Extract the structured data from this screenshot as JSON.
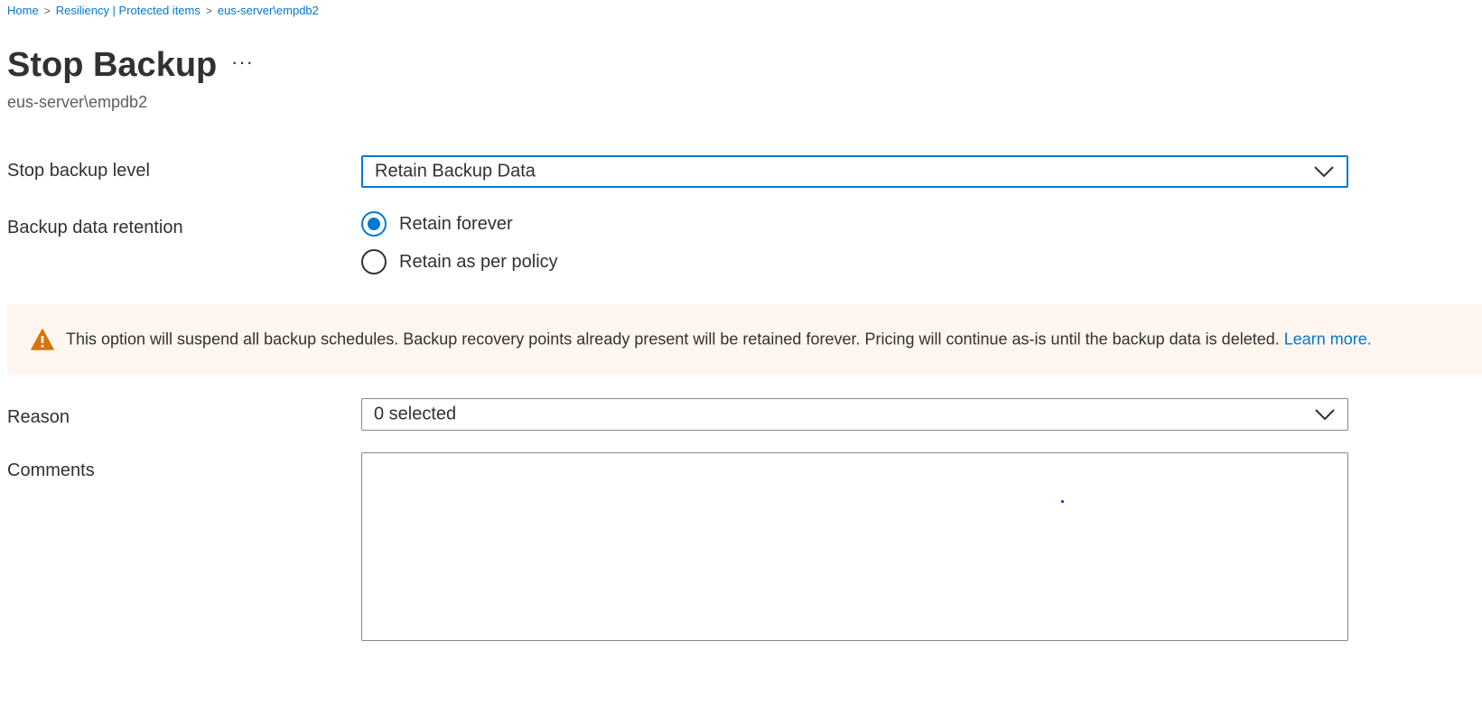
{
  "breadcrumb": {
    "items": [
      "Home",
      "Resiliency | Protected items",
      "eus-server\\empdb2"
    ],
    "separator": ">"
  },
  "header": {
    "title": "Stop Backup",
    "more_label": "···",
    "subtitle": "eus-server\\empdb2"
  },
  "form": {
    "stop_level": {
      "label": "Stop backup level",
      "value": "Retain Backup Data"
    },
    "retention": {
      "label": "Backup data retention",
      "options": [
        {
          "label": "Retain forever",
          "checked": true
        },
        {
          "label": "Retain as per policy",
          "checked": false
        }
      ]
    },
    "warning": {
      "icon": "warning-icon",
      "text": "This option will suspend all backup schedules. Backup recovery points already present will be retained forever. Pricing will continue as-is until the backup data is deleted.",
      "link": "Learn more."
    },
    "reason": {
      "label": "Reason",
      "value": "0 selected"
    },
    "comments": {
      "label": "Comments",
      "value": ""
    }
  },
  "colors": {
    "accent": "#0078d4",
    "warning": "#d9730d",
    "banner_bg": "#fff6ef",
    "text": "#323130"
  }
}
